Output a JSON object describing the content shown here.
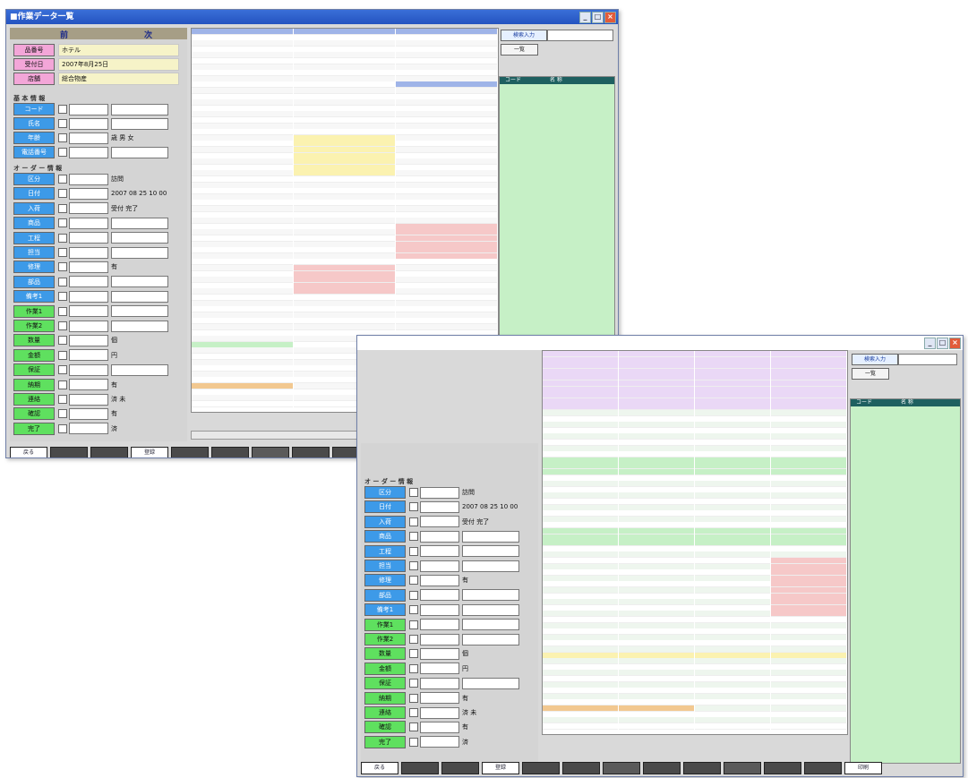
{
  "window1": {
    "title": "■作業データ一覧",
    "topbar": {
      "left": "前",
      "right": "次"
    },
    "info_rows": [
      {
        "label": "品番号",
        "value": "ホテル",
        "color": "pink"
      },
      {
        "label": "受付日",
        "value": "2007年8月25日",
        "color": "pink"
      },
      {
        "label": "店舗",
        "value": "総合物産",
        "color": "pink"
      }
    ],
    "section_basic": "基 本 情 報",
    "basic_rows": [
      {
        "label": "コード",
        "color": "blue"
      },
      {
        "label": "氏名",
        "color": "blue"
      },
      {
        "label": "年齢",
        "color": "blue",
        "extra": "歳  男 女"
      },
      {
        "label": "電話番号",
        "color": "blue"
      }
    ],
    "section_order": "オ ー ダ ー 情 報",
    "order_rows": [
      {
        "label": "区分",
        "color": "blue",
        "extra": "訪問"
      },
      {
        "label": "日付",
        "color": "blue",
        "extra": "2007  08  25  10  00"
      },
      {
        "label": "入荷",
        "color": "blue",
        "extra": "受付 完了"
      },
      {
        "label": "商品",
        "color": "blue"
      },
      {
        "label": "工程",
        "color": "blue"
      },
      {
        "label": "担当",
        "color": "blue"
      },
      {
        "label": "修理",
        "color": "blue",
        "extra": "有"
      },
      {
        "label": "部品",
        "color": "blue"
      },
      {
        "label": "備考1",
        "color": "blue"
      },
      {
        "label": "作業1",
        "color": "green"
      },
      {
        "label": "作業2",
        "color": "green"
      },
      {
        "label": "数量",
        "color": "green",
        "extra": "個"
      },
      {
        "label": "金額",
        "color": "green",
        "extra": "円"
      },
      {
        "label": "保証",
        "color": "green"
      },
      {
        "label": "納期",
        "color": "green",
        "extra": "有"
      },
      {
        "label": "連絡",
        "color": "green",
        "extra": "済 未"
      },
      {
        "label": "確認",
        "color": "green",
        "extra": "有"
      },
      {
        "label": "完了",
        "color": "green",
        "extra": "済"
      }
    ],
    "right_buttons": [
      "検索入力",
      "一覧"
    ],
    "right_header": [
      "コード",
      "名 称"
    ],
    "bottom_buttons": [
      "戻る",
      "",
      "",
      "登録",
      "",
      "",
      "",
      "",
      "",
      "",
      "",
      "",
      "印刷"
    ]
  },
  "window2": {
    "title": "",
    "right_buttons": [
      "検索入力",
      "一覧"
    ],
    "right_header": [
      "コード",
      "名 称"
    ],
    "bottom_buttons": [
      "戻る",
      "",
      "",
      "登録",
      "",
      "",
      "",
      "",
      "",
      "",
      "",
      "",
      "印刷"
    ]
  }
}
